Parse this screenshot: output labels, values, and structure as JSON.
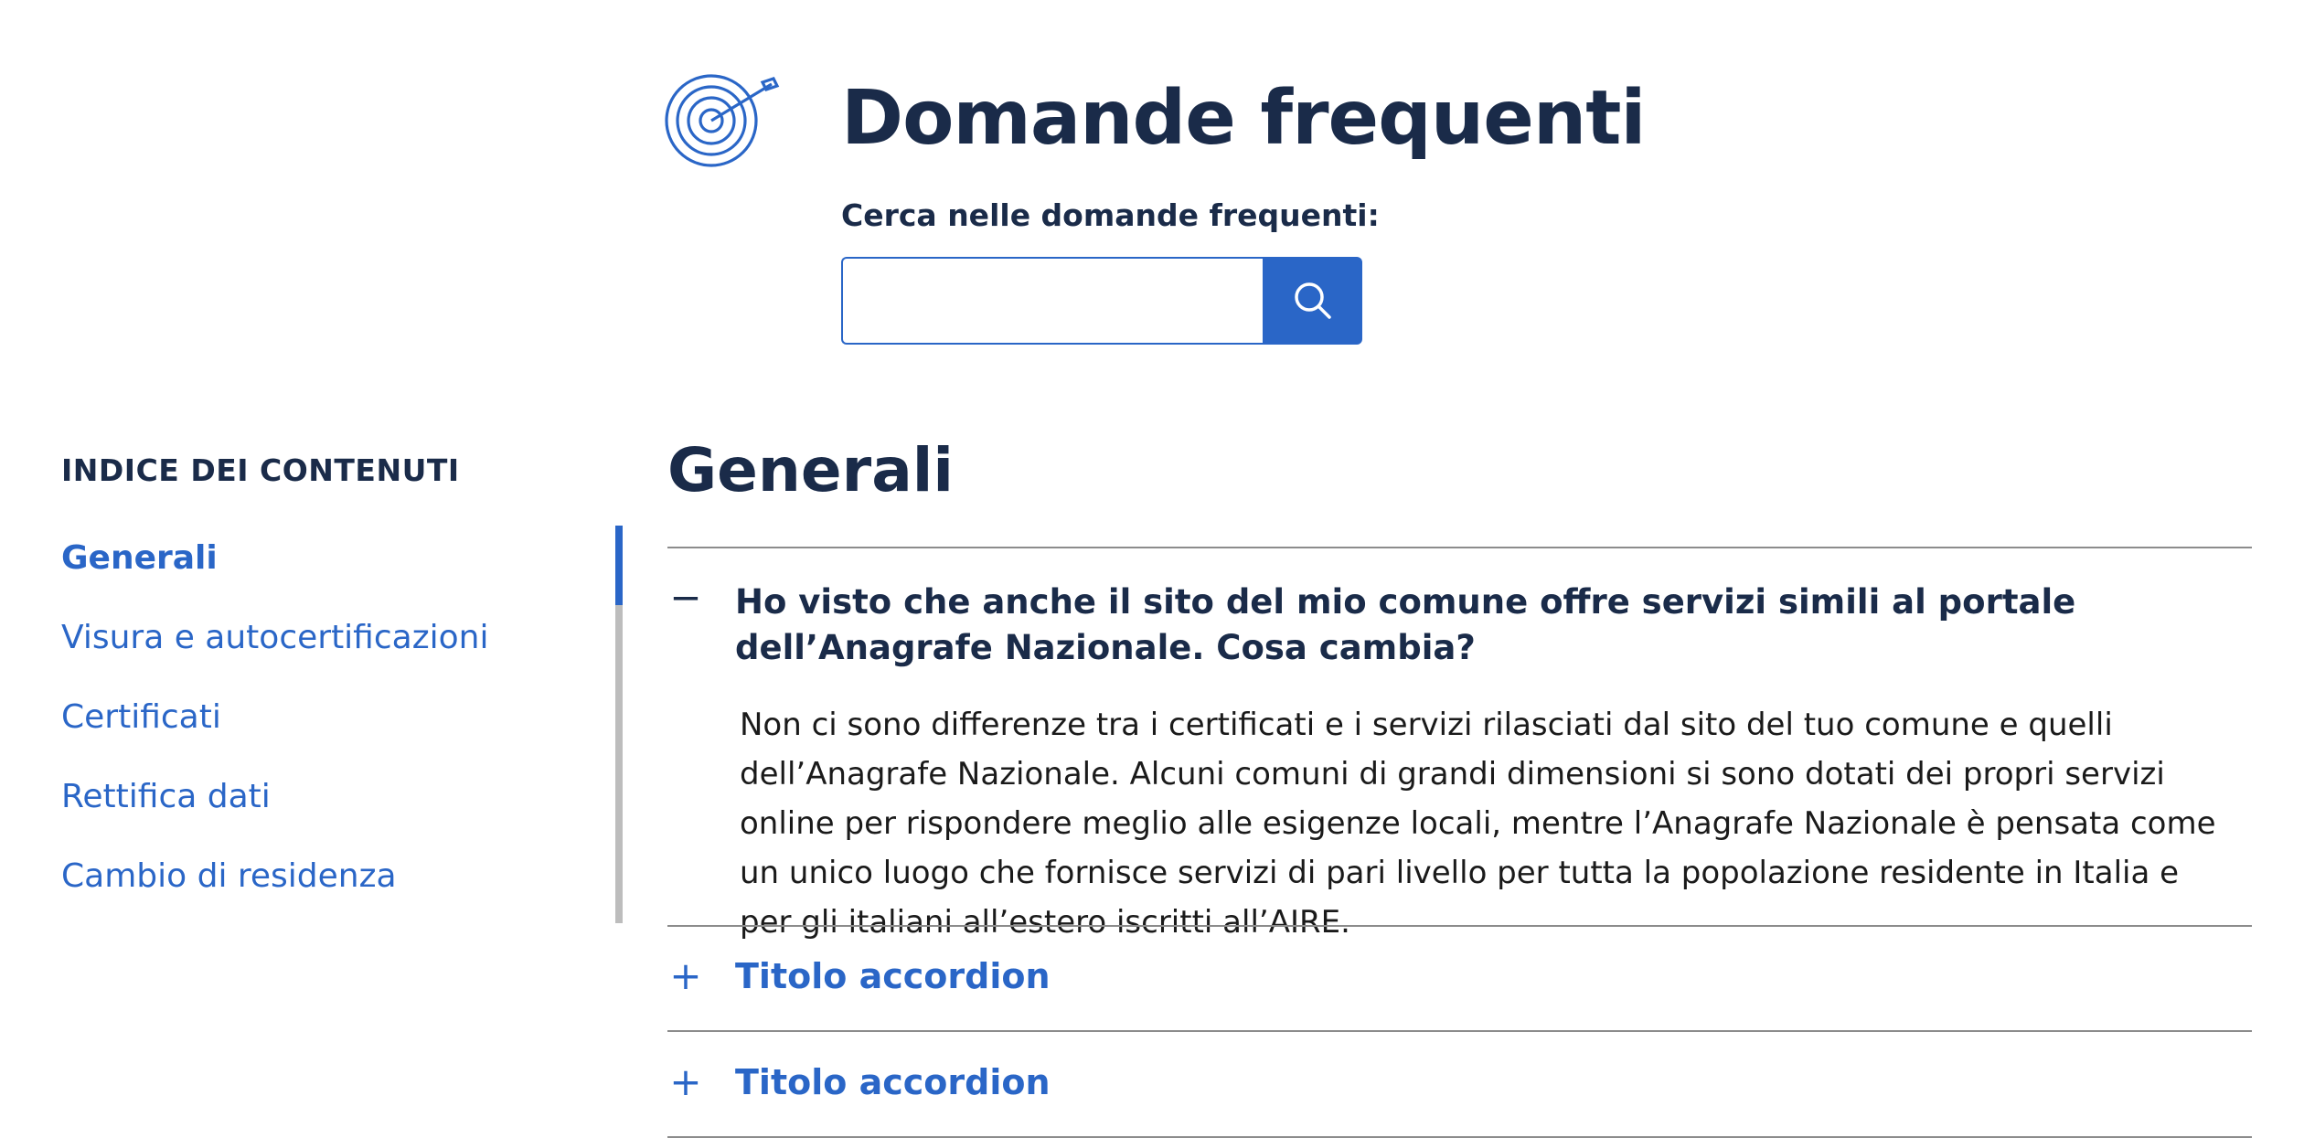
{
  "header": {
    "icon": "target-icon",
    "title": "Domande frequenti",
    "search": {
      "label": "Cerca nelle domande frequenti:",
      "value": "",
      "placeholder": "",
      "button_icon": "search-icon"
    }
  },
  "sidebar": {
    "title": "INDICE DEI CONTENUTI",
    "items": [
      {
        "label": "Generali",
        "active": true
      },
      {
        "label": "Visura e autocertificazioni"
      },
      {
        "label": "Certificati"
      },
      {
        "label": "Rettifica dati"
      },
      {
        "label": "Cambio di residenza"
      }
    ],
    "progress_fraction": 0.2
  },
  "main": {
    "section_title": "Generali",
    "accordions": [
      {
        "toggle": "−",
        "expanded": true,
        "title": "Ho visto che anche il sito del mio comune offre servizi simili al portale dell’Anagrafe Nazionale. Cosa cambia?",
        "body": "Non ci sono differenze tra i certificati e i servizi rilasciati dal sito del tuo comune e quelli dell’Anagrafe Nazionale. Alcuni comuni di grandi dimensioni si sono dotati dei propri servizi online per rispondere meglio alle esigenze locali, mentre l’Anagrafe Nazionale è pensata come un unico luogo che fornisce servizi di pari livello per tutta la popolazione residente in Italia e per gli italiani all’estero iscritti all’AIRE."
      },
      {
        "toggle": "+",
        "expanded": false,
        "title": "Titolo accordion"
      },
      {
        "toggle": "+",
        "expanded": false,
        "title": "Titolo accordion"
      }
    ]
  },
  "colors": {
    "primary": "#2a66c7",
    "heading": "#1a2b49",
    "divider": "#8c8c8c",
    "track": "#bdbdbd"
  }
}
